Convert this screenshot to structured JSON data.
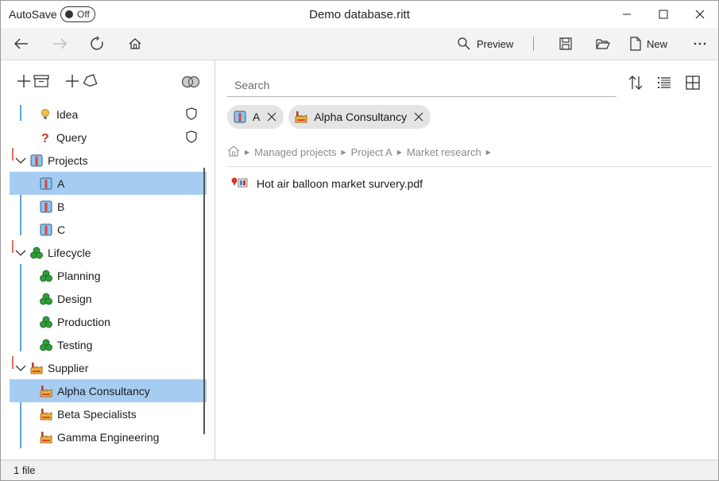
{
  "window": {
    "title": "Demo database.ritt",
    "autosave_label": "AutoSave",
    "autosave_state": "Off"
  },
  "toolbar": {
    "preview_label": "Preview",
    "new_label": "New"
  },
  "sidebar": {
    "items": [
      {
        "label": "Idea",
        "icon": "lightbulb-icon",
        "has_shield": true
      },
      {
        "label": "Query",
        "icon": "question-icon",
        "has_shield": true
      },
      {
        "label": "Projects",
        "icon": "project-icon",
        "expanded": true
      },
      {
        "label": "A",
        "icon": "project-icon",
        "selected": true
      },
      {
        "label": "B",
        "icon": "project-icon"
      },
      {
        "label": "C",
        "icon": "project-icon"
      },
      {
        "label": "Lifecycle",
        "icon": "recycle-icon",
        "expanded": true
      },
      {
        "label": "Planning",
        "icon": "recycle-icon"
      },
      {
        "label": "Design",
        "icon": "recycle-icon"
      },
      {
        "label": "Production",
        "icon": "recycle-icon"
      },
      {
        "label": "Testing",
        "icon": "recycle-icon"
      },
      {
        "label": "Supplier",
        "icon": "factory-icon",
        "expanded": true
      },
      {
        "label": "Alpha Consultancy",
        "icon": "factory-icon",
        "selected": true
      },
      {
        "label": "Beta Specialists",
        "icon": "factory-icon"
      },
      {
        "label": "Gamma Engineering",
        "icon": "factory-icon"
      }
    ]
  },
  "main": {
    "search_placeholder": "Search",
    "chips": [
      {
        "label": "A",
        "icon": "project-icon"
      },
      {
        "label": "Alpha Consultancy",
        "icon": "factory-icon"
      }
    ],
    "breadcrumb": [
      "Managed projects",
      "Project A",
      "Market research"
    ],
    "files": [
      {
        "name": "Hot air balloon market survery.pdf",
        "icon": "pdf-file-icon"
      }
    ]
  },
  "status": {
    "text": "1 file"
  },
  "colors": {
    "selection": "#a6cdf1",
    "guide_blue": "#5aa6d6",
    "guide_red": "#e07060",
    "toolbar_bg": "#f3f3f3",
    "chip_bg": "#e4e4e4"
  }
}
